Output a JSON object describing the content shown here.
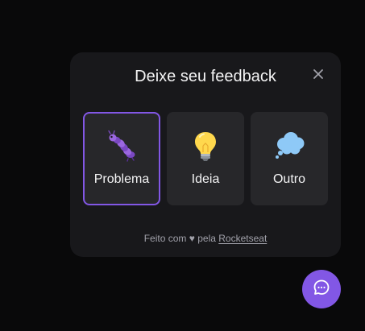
{
  "widget": {
    "title": "Deixe seu feedback",
    "close_icon": "close-icon",
    "options": [
      {
        "label": "Problema",
        "icon": "bug-icon",
        "selected": true
      },
      {
        "label": "Ideia",
        "icon": "lightbulb-icon",
        "selected": false
      },
      {
        "label": "Outro",
        "icon": "thought-bubble-icon",
        "selected": false
      }
    ],
    "footer": {
      "prefix": "Feito com",
      "heart": "♥",
      "middle": "pela",
      "link": "Rocketseat"
    }
  },
  "fab": {
    "icon": "chat-icon"
  },
  "colors": {
    "background": "#09090a",
    "panel": "#18181b",
    "card": "#27272a",
    "accent": "#8257e5",
    "text": "#f4f4f5",
    "muted": "#a1a1aa"
  }
}
